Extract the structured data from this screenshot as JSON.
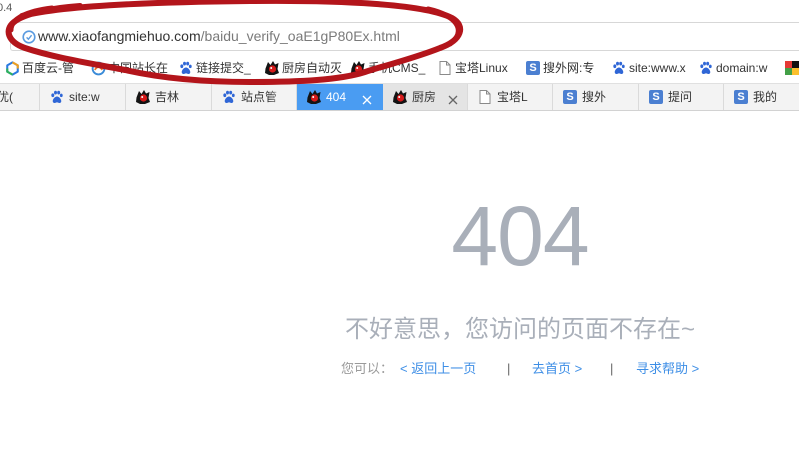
{
  "version_text": "0.4",
  "address_bar": {
    "icon": "security-shield-icon",
    "url_host": "www.xiaofangmiehuo.com",
    "url_path": "/baidu_verify_oaE1gP80Ex.html"
  },
  "bookmarks": [
    {
      "label": "百度云-管",
      "icon": "baidu-cloud-icon"
    },
    {
      "label": "中国站长在",
      "icon": "chinaz-icon"
    },
    {
      "label": "链接提交_",
      "icon": "baidu-paw-icon"
    },
    {
      "label": "厨房自动灭",
      "icon": "site-logo-icon"
    },
    {
      "label": "手机CMS_",
      "icon": "site-logo-icon"
    },
    {
      "label": "宝塔Linux",
      "icon": "page-icon"
    },
    {
      "label": "搜外网:专",
      "icon": "souwai-icon"
    },
    {
      "label": "site:www.x",
      "icon": "baidu-paw-icon"
    },
    {
      "label": "domain:w",
      "icon": "baidu-paw-icon"
    },
    {
      "icon": "colorful-grid-icon"
    }
  ],
  "tabs": [
    {
      "label": "优(",
      "icon": null
    },
    {
      "label": "site:w",
      "icon": "baidu-paw-icon"
    },
    {
      "label": "吉林",
      "icon": "site-logo-icon"
    },
    {
      "label": "站点管",
      "icon": "baidu-paw-icon"
    },
    {
      "label": "404",
      "icon": "site-logo-icon",
      "active": true,
      "closable": true
    },
    {
      "label": "厨房",
      "icon": "site-logo-icon",
      "hovered": true,
      "closable": true
    },
    {
      "label": "宝塔L",
      "icon": "page-icon"
    },
    {
      "label": "搜外",
      "icon": "souwai-icon"
    },
    {
      "label": "提问",
      "icon": "souwai-icon"
    },
    {
      "label": "我的",
      "icon": "souwai-icon"
    }
  ],
  "icon_text": {
    "souwai_letter": "S"
  },
  "error_page": {
    "code": "404",
    "message": "不好意思，您访问的页面不存在~",
    "hint": "您可以：",
    "separator": "|",
    "links": [
      {
        "label": "< 返回上一页"
      },
      {
        "label": "去首页 >"
      },
      {
        "label": "寻求帮助 >"
      }
    ]
  },
  "colors": {
    "active_tab": "#4a9cf2",
    "annotation": "#b3151b",
    "link": "#3d8ee6",
    "error_text": "#a9afb9",
    "baidu_paw": "#2f66d6",
    "souwai": "#4b7fd1"
  }
}
